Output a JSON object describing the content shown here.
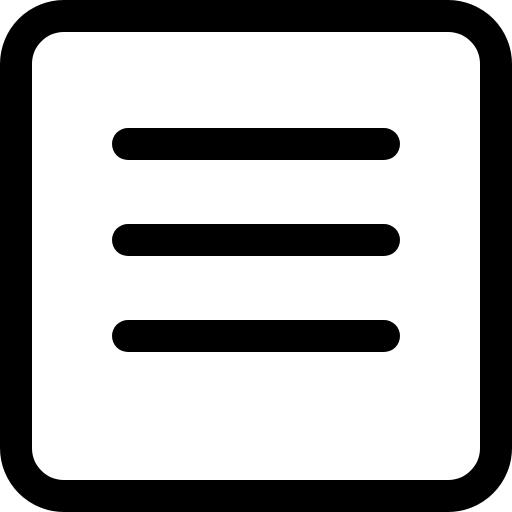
{
  "icon": {
    "name": "menu-square-icon",
    "stroke_color": "#000000",
    "fill_color": "#ffffff",
    "line_count": 3
  }
}
